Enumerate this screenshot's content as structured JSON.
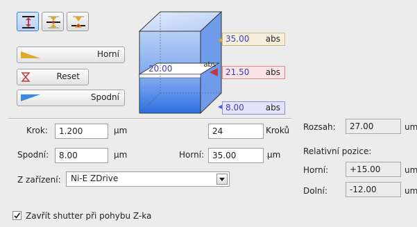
{
  "toolbar": {
    "mode_buttons": [
      "range",
      "center",
      "offset"
    ],
    "horni_label": "Horní",
    "reset_label": "Reset",
    "spodni_label": "Spodní"
  },
  "diagram": {
    "top_value": "35.00",
    "top_unit": "abs",
    "middle_value": "20.00",
    "middle_unit": "abs",
    "current_value": "21.50",
    "current_unit": "abs",
    "bottom_value": "8.00",
    "bottom_unit": "abs"
  },
  "params": {
    "krok_label": "Krok:",
    "krok_value": "1.200",
    "krok_unit": "µm",
    "kroku_value": "24",
    "kroku_label": "Kroků",
    "spodni_label": "Spodní:",
    "spodni_value": "8.00",
    "spodni_unit": "µm",
    "horni_label": "Horní:",
    "horni_value": "35.00",
    "horni_unit": "µm",
    "zarizeni_label": "Z zařízení:",
    "zarizeni_value": "Ni-E ZDrive"
  },
  "range": {
    "rozsah_label": "Rozsah:",
    "rozsah_value": "27.00",
    "rozsah_unit": "um",
    "relativni_label": "Relativní pozice:",
    "horni_label": "Horní:",
    "horni_value": "+15.00",
    "horni_unit": "um",
    "dolni_label": "Dolní:",
    "dolni_value": "-12.00",
    "dolni_unit": "um"
  },
  "shutter": {
    "label": "Zavřít shutter při pohybu Z-ka",
    "checked": true
  },
  "colors": {
    "accent_blue": "#3a7bd5",
    "top_marker": "#e0a82a",
    "current_marker": "#c0393b",
    "bottom_marker": "#4a5bd8"
  }
}
